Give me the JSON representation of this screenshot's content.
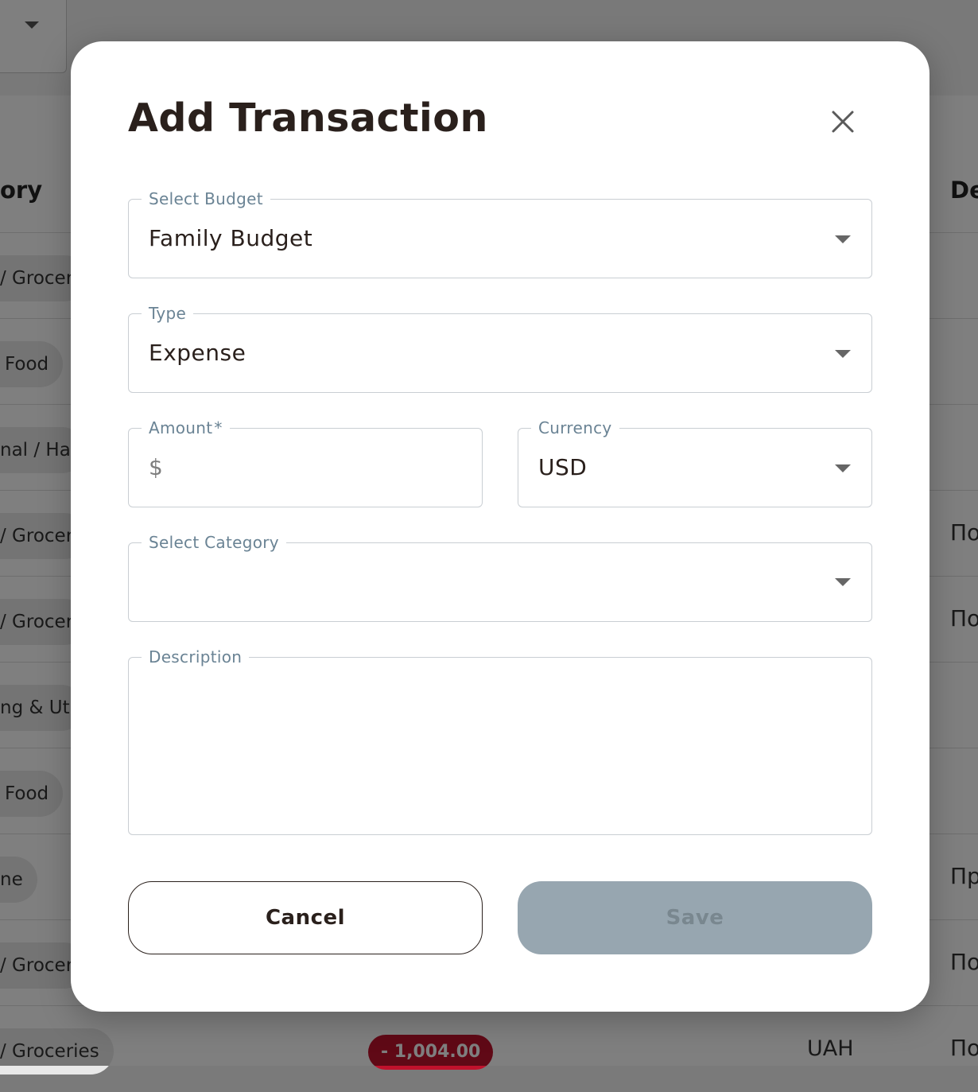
{
  "background": {
    "table_header": {
      "category": "ory",
      "description": "De"
    },
    "rows": [
      {
        "chip": "/ Grocer",
        "chip_left": 0,
        "desc": ""
      },
      {
        "chip": "Food",
        "desc": ""
      },
      {
        "chip": "nal / Ha",
        "desc": ""
      },
      {
        "chip": "/ Grocer",
        "desc": "По"
      },
      {
        "chip": "/ Grocer",
        "desc": "По"
      },
      {
        "chip": "ng & Ut",
        "desc": ""
      },
      {
        "chip": "Food",
        "desc": ""
      },
      {
        "chip": "ne",
        "desc": "Пр"
      },
      {
        "chip": "/ Grocer",
        "desc": "По"
      },
      {
        "chip": "/ Groceries",
        "desc": "По",
        "amount": "- 1,004.00",
        "currency": "UAH"
      }
    ]
  },
  "modal": {
    "title": "Add Transaction",
    "budget": {
      "label": "Select Budget",
      "value": "Family Budget"
    },
    "type": {
      "label": "Type",
      "value": "Expense"
    },
    "amount": {
      "label": "Amount",
      "required_mark": "*",
      "prefix": "$",
      "value": ""
    },
    "currency": {
      "label": "Currency",
      "value": "USD"
    },
    "category": {
      "label": "Select Category",
      "value": ""
    },
    "description": {
      "label": "Description",
      "value": ""
    },
    "cancel_label": "Cancel",
    "save_label": "Save"
  },
  "icons": {
    "close": "close-icon",
    "dropdown": "chevron-down-icon"
  },
  "colors": {
    "title": "#2a201c",
    "label": "#6a8394",
    "save_disabled_bg": "#97a6b0",
    "amount_badge": "#c0122c"
  }
}
